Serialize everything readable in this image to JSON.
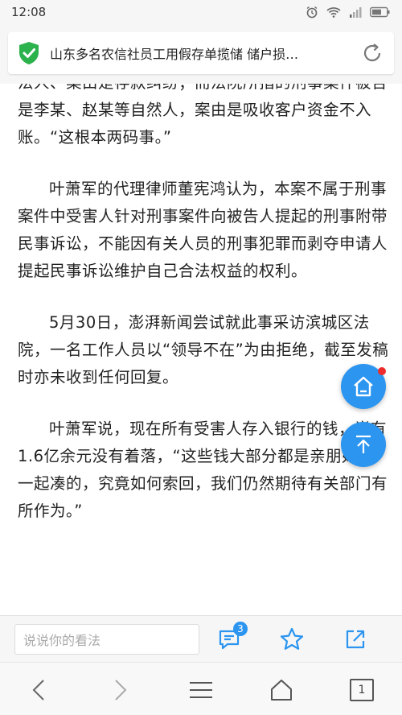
{
  "status": {
    "time": "12:08"
  },
  "url": {
    "title": "山东多名农信社员工用假存单揽储 储户损…"
  },
  "article": {
    "paragraphs": [
      "法人、案由是存款纠纷；而法院所指的刑事案件被告是李某、赵某等自然人，案由是吸收客户资金不入账。“这根本两码事。”",
      "叶萧军的代理律师董宪鸿认为，本案不属于刑事案件中受害人针对刑事案件向被告人提起的刑事附带民事诉讼，不能因有关人员的刑事犯罪而剥夺申请人提起民事诉讼维护自己合法权益的权利。",
      "5月30日，澎湃新闻尝试就此事采访滨城区法院，一名工作人员以“领导不在”为由拒绝，截至发稿时亦未收到任何回复。",
      "叶萧军说，现在所有受害人存入银行的钱，尚有1.6亿余元没有着落，“这些钱大部分都是亲朋好友一起凑的，究竟如何索回，我们仍然期待有关部门有所作为。”"
    ]
  },
  "comment": {
    "placeholder": "说说你的看法",
    "count": "3"
  },
  "nav": {
    "tabs": "1"
  },
  "colors": {
    "accent": "#2b95f0",
    "shield": "#2bb24c",
    "dot": "#ee2c2c"
  },
  "icons": [
    "alarm-icon",
    "wifi-icon",
    "signal-icon",
    "battery-icon",
    "shield-check-icon",
    "reload-icon",
    "home-icon",
    "arrow-up-icon",
    "comments-icon",
    "star-icon",
    "share-icon",
    "back-icon",
    "forward-icon",
    "menu-icon",
    "home-nav-icon",
    "tabs-icon"
  ]
}
